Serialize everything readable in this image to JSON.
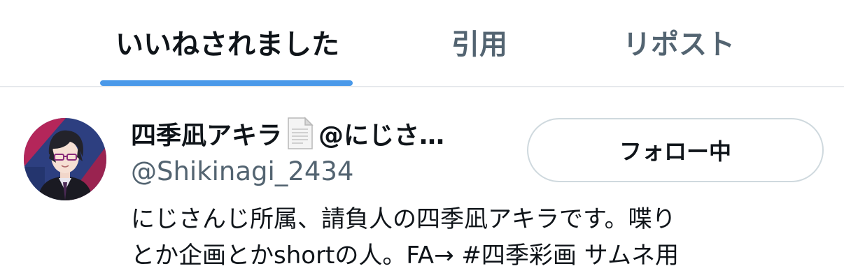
{
  "tabs": {
    "items": [
      {
        "label": "いいねされました",
        "active": true
      },
      {
        "label": "引用",
        "active": false
      },
      {
        "label": "リポスト",
        "active": false
      }
    ]
  },
  "colors": {
    "accent": "#4a99e9",
    "text": "#0f1419",
    "secondary_text": "#536471",
    "divider": "#e6e9ec"
  },
  "user": {
    "display_name": "四季凪アキラ",
    "name_emoji": "page-facing-up-icon",
    "name_suffix": "@にじさ…",
    "handle": "@Shikinagi_2434",
    "follow_button_label": "フォロー中",
    "bio_lines": [
      "にじさんじ所属、請負人の四季凪アキラです。喋り",
      "とか企画とかshortの人。FA→ #四季彩画 サムネ用"
    ]
  }
}
